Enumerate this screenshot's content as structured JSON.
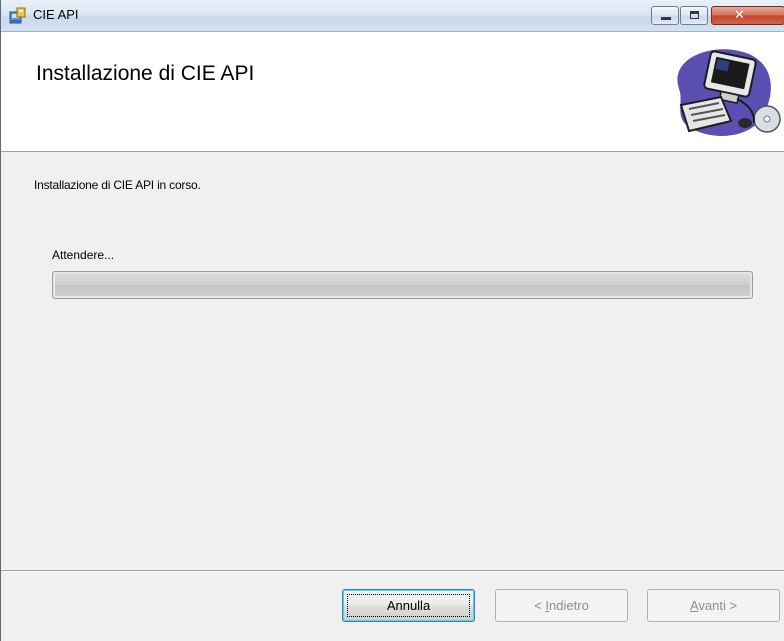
{
  "window": {
    "title": "CIE API",
    "close_glyph": "✕"
  },
  "header": {
    "title": "Installazione di CIE API"
  },
  "main": {
    "status_text": "Installazione di CIE API in corso.",
    "wait_label": "Attendere...",
    "progress": 0
  },
  "buttons": {
    "cancel_label": "Annulla",
    "back_prefix": "< ",
    "back_accel": "I",
    "back_rest": "ndietro",
    "next_accel": "A",
    "next_rest": "vanti >"
  },
  "colors": {
    "close_button": "#c2462e",
    "default_button_border": "#3c7fb1"
  }
}
